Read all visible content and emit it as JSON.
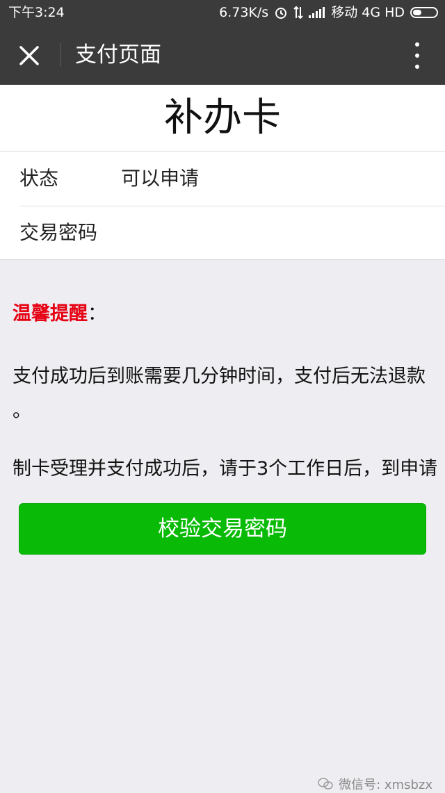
{
  "status_bar": {
    "time": "下午3:24",
    "speed": "6.73K/s",
    "carrier": "移动 4G HD"
  },
  "title_bar": {
    "title": "支付页面"
  },
  "heading": "补办卡",
  "form": {
    "status_label": "状态",
    "status_value": "可以申请",
    "password_label": "交易密码",
    "password_value": ""
  },
  "notice": {
    "title": "温馨提醒",
    "colon": "：",
    "para1": "支付成功后到账需要几分钟时间，支付后无法退款",
    "para1_tail": "。",
    "para2": "制卡受理并支付成功后，请于3个工作日后，到申请"
  },
  "button": {
    "verify_label": "校验交易密码"
  },
  "watermark": {
    "text": "微信号: xmsbzx"
  },
  "colors": {
    "bar": "#3b3b3b",
    "accent_green": "#09bb07",
    "notice_red": "#e60012",
    "background": "#eeedf1"
  }
}
